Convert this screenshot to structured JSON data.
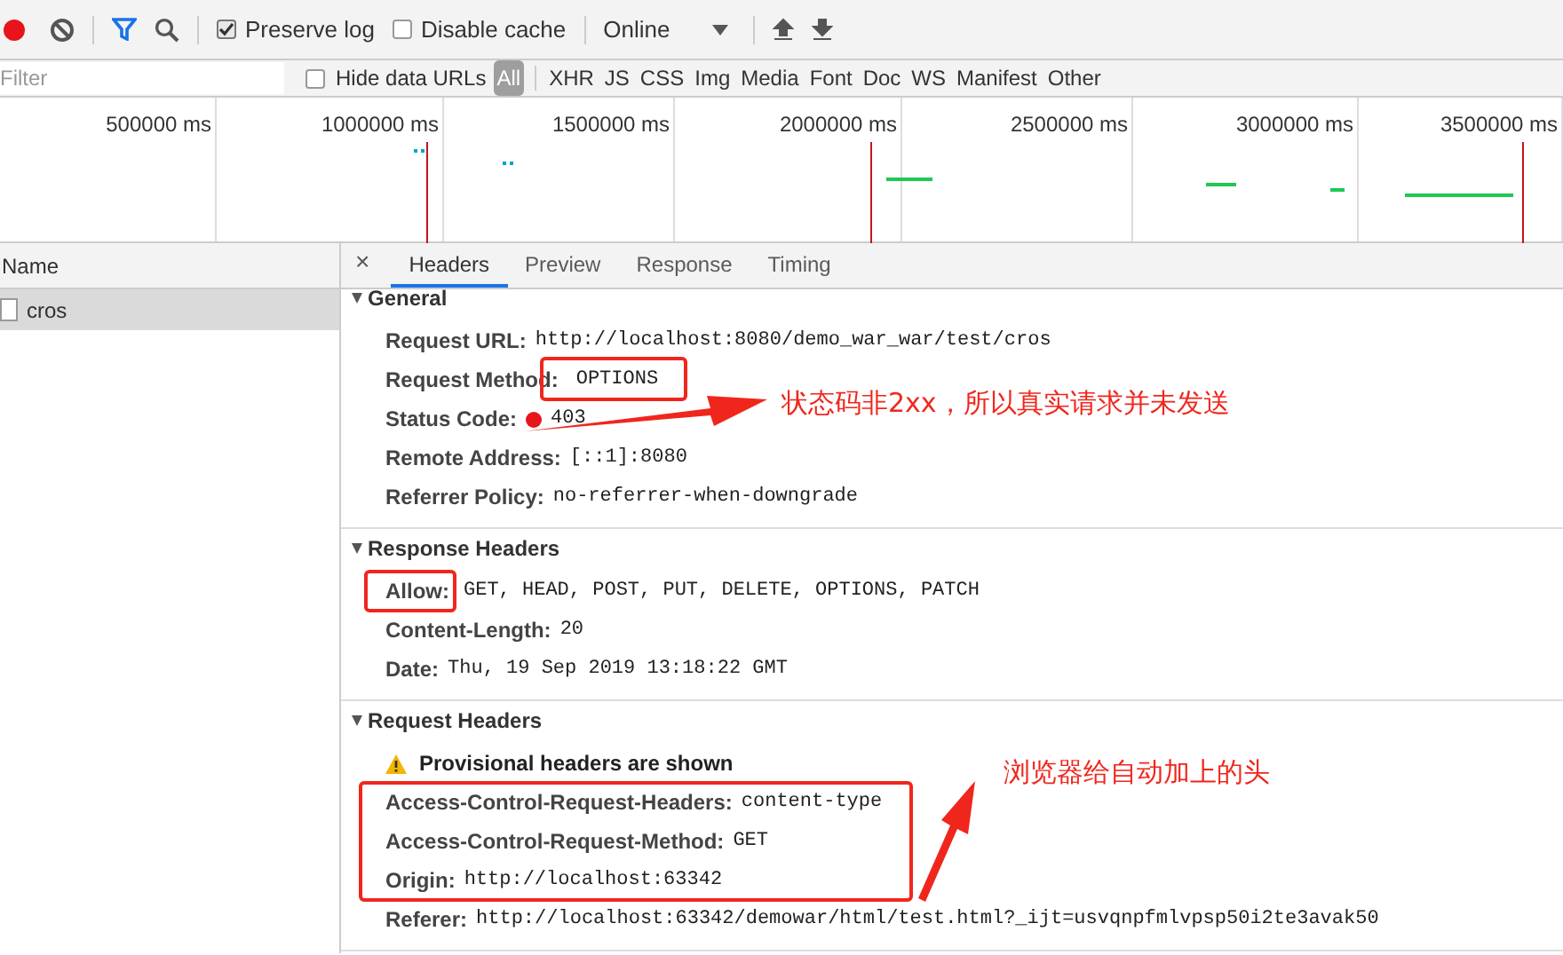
{
  "toolbar": {
    "preserve_log": {
      "label": "Preserve log",
      "checked": true
    },
    "disable_cache": {
      "label": "Disable cache",
      "checked": false
    },
    "throttle": "Online"
  },
  "filter": {
    "placeholder": "Filter",
    "hide_data_urls": {
      "label": "Hide data URLs",
      "checked": false
    },
    "types": [
      {
        "label": "All",
        "selected": true
      },
      {
        "label": "XHR",
        "selected": false
      },
      {
        "label": "JS",
        "selected": false
      },
      {
        "label": "CSS",
        "selected": false
      },
      {
        "label": "Img",
        "selected": false
      },
      {
        "label": "Media",
        "selected": false
      },
      {
        "label": "Font",
        "selected": false
      },
      {
        "label": "Doc",
        "selected": false
      },
      {
        "label": "WS",
        "selected": false
      },
      {
        "label": "Manifest",
        "selected": false
      },
      {
        "label": "Other",
        "selected": false
      }
    ]
  },
  "timeline": {
    "ticks": [
      "500000 ms",
      "1000000 ms",
      "1500000 ms",
      "2000000 ms",
      "2500000 ms",
      "3000000 ms",
      "3500000 ms"
    ]
  },
  "requests": {
    "column": "Name",
    "rows": [
      {
        "name": "cros",
        "selected": true
      }
    ]
  },
  "detail": {
    "close": "×",
    "tabs": [
      {
        "label": "Headers",
        "selected": true
      },
      {
        "label": "Preview",
        "selected": false
      },
      {
        "label": "Response",
        "selected": false
      },
      {
        "label": "Timing",
        "selected": false
      }
    ],
    "sections": [
      {
        "title": "General",
        "expanded": true,
        "rows": [
          {
            "kind": "field",
            "key": "Request URL:",
            "value": "http://localhost:8080/demo_war_war/test/cros"
          },
          {
            "kind": "field",
            "key": "Request Method:",
            "value": "OPTIONS"
          },
          {
            "kind": "status",
            "key": "Status Code:",
            "value": "403",
            "color": "#e8141b"
          },
          {
            "kind": "field",
            "key": "Remote Address:",
            "value": "[::1]:8080"
          },
          {
            "kind": "field",
            "key": "Referrer Policy:",
            "value": "no-referrer-when-downgrade"
          }
        ]
      },
      {
        "title": "Response Headers",
        "expanded": true,
        "rows": [
          {
            "kind": "field",
            "key": "Allow:",
            "value": "GET, HEAD, POST, PUT, DELETE, OPTIONS, PATCH"
          },
          {
            "kind": "field",
            "key": "Content-Length:",
            "value": "20"
          },
          {
            "kind": "field",
            "key": "Date:",
            "value": "Thu, 19 Sep 2019 13:18:22 GMT"
          }
        ]
      },
      {
        "title": "Request Headers",
        "expanded": true,
        "rows": [
          {
            "kind": "warning",
            "key": "Provisional headers are shown"
          },
          {
            "kind": "field",
            "key": "Access-Control-Request-Headers:",
            "value": "content-type"
          },
          {
            "kind": "field",
            "key": "Access-Control-Request-Method:",
            "value": "GET"
          },
          {
            "kind": "field",
            "key": "Origin:",
            "value": "http://localhost:63342"
          },
          {
            "kind": "field",
            "key": "Referer:",
            "value": "http://localhost:63342/demowar/html/test.html?_ijt=usvqnpfmlvpsp50i2te3avak50"
          }
        ]
      }
    ]
  },
  "annotations": [
    {
      "text": "状态码非2xx，所以真实请求并未发送"
    },
    {
      "text": "浏览器给自动加上的头"
    }
  ]
}
